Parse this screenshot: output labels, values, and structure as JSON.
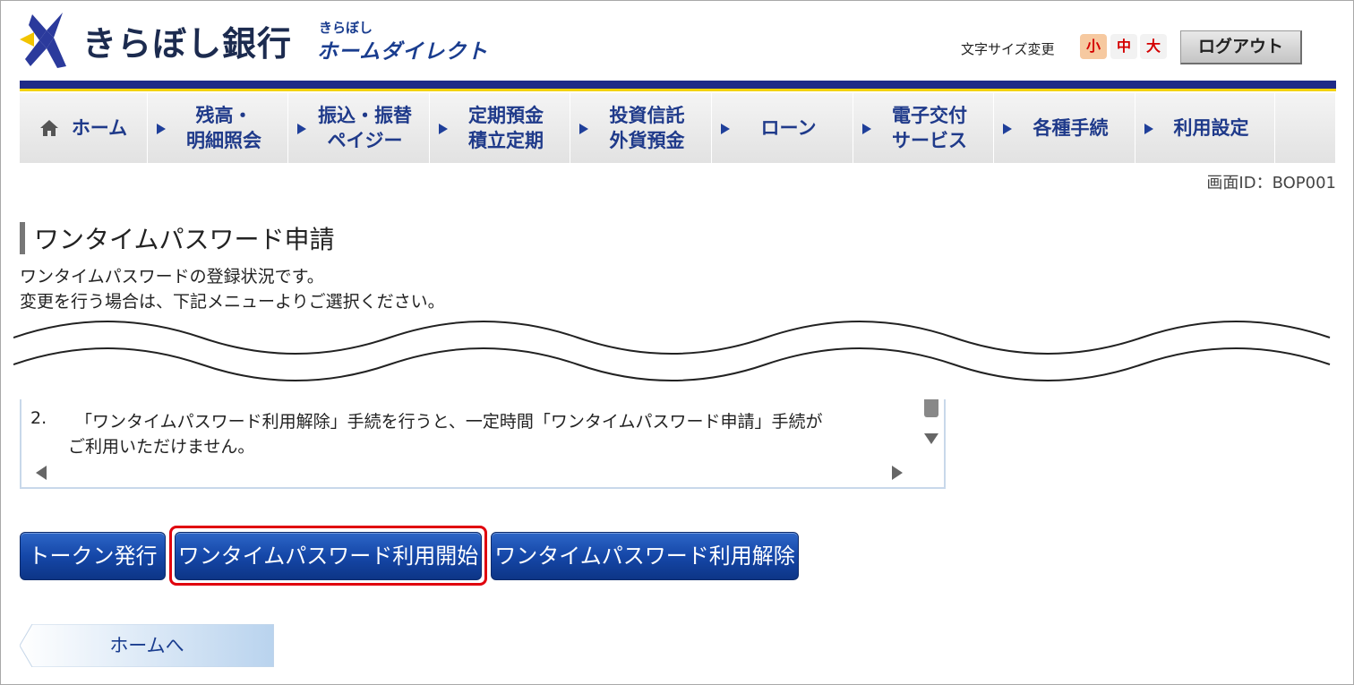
{
  "header": {
    "bank_name": "きらぼし銀行",
    "service_small": "きらぼし",
    "service_name": "ホームダイレクト",
    "fontsize_label": "文字サイズ変更",
    "fontsize_small": "小",
    "fontsize_medium": "中",
    "fontsize_large": "大",
    "logout_label": "ログアウト"
  },
  "nav": {
    "items": [
      {
        "label": "ホーム"
      },
      {
        "label": "残高・\n明細照会"
      },
      {
        "label": "振込・振替\nペイジー"
      },
      {
        "label": "定期預金\n積立定期"
      },
      {
        "label": "投資信託\n外貨預金"
      },
      {
        "label": "ローン"
      },
      {
        "label": "電子交付\nサービス"
      },
      {
        "label": "各種手続"
      },
      {
        "label": "利用設定"
      }
    ]
  },
  "screen_id": "画面ID：BOP001",
  "page": {
    "title": "ワンタイムパスワード申請",
    "desc_line1": "ワンタイムパスワードの登録状況です。",
    "desc_line2": "変更を行う場合は、下記メニューよりご選択ください。"
  },
  "notice": {
    "number": "2.",
    "line1": "「ワンタイムパスワード利用解除」手続を行うと、一定時間「ワンタイムパスワード申請」手続が",
    "line2": "ご利用いただけません。"
  },
  "actions": {
    "token_issue": "トークン発行",
    "otp_start": "ワンタイムパスワード利用開始",
    "otp_cancel": "ワンタイムパスワード利用解除"
  },
  "back_home_label": "ホームへ",
  "colors": {
    "nav_bar": "#1f2a87",
    "nav_accent": "#f3d200",
    "button_blue": "#1547a8",
    "highlight_red": "#e0000d"
  }
}
